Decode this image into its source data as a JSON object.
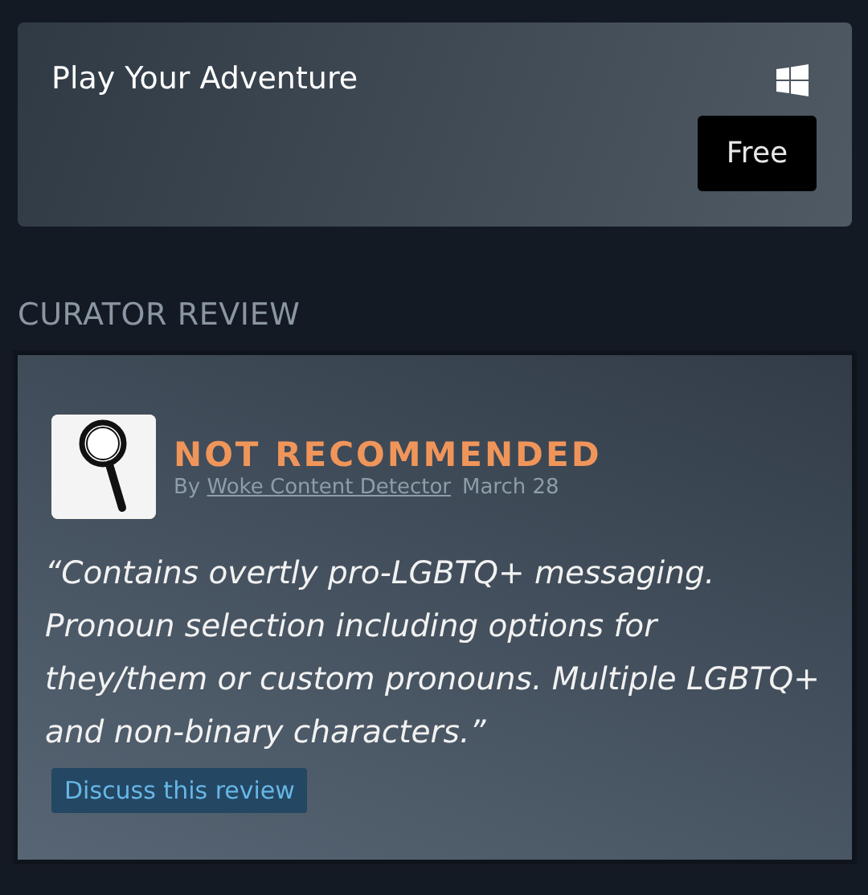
{
  "game": {
    "title": "Play Your Adventure",
    "price": "Free"
  },
  "section_heading": "CURATOR REVIEW",
  "review": {
    "recommended": false,
    "verdict": "NOT RECOMMENDED",
    "by": "By",
    "curator": "Woke Content Detector",
    "date": "March 28",
    "text": "“Contains overtly pro-LGBTQ+ messaging. Pronoun selection including options for they/them or custom pronouns. Multiple LGBTQ+ and non-binary characters.”",
    "discuss": "Discuss this review"
  }
}
